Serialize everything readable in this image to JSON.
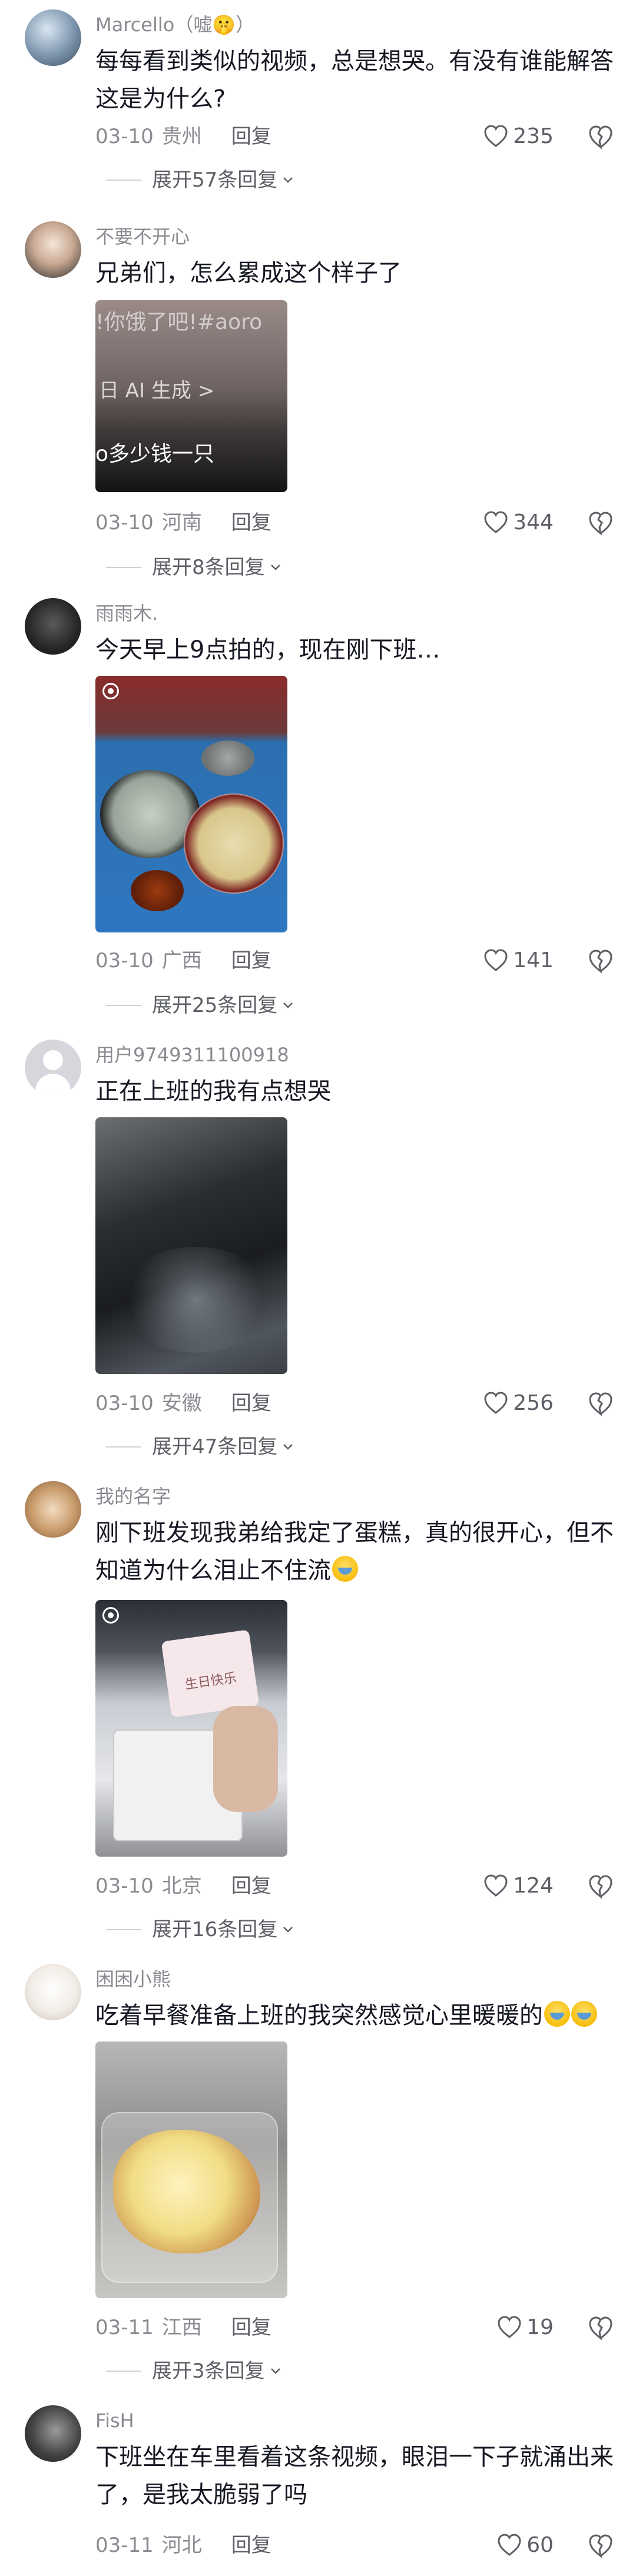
{
  "comments": [
    {
      "username": "Marcello（嘘🤫）",
      "text": "每每看到类似的视频，总是想哭。有没有谁能解答这是为什么?",
      "date": "03-10",
      "location": "贵州",
      "reply": "回复",
      "likes": "235",
      "expand": "展开57条回复"
    },
    {
      "username": "不要不开心",
      "text": "兄弟们，怎么累成这个样子了",
      "image_text_1": "!你饿了吧!#aoro",
      "image_text_2": "日 AI 生成 >",
      "image_text_3": "o多少钱一只",
      "date": "03-10",
      "location": "河南",
      "reply": "回复",
      "likes": "344",
      "expand": "展开8条回复"
    },
    {
      "username": "雨雨木.",
      "text": "今天早上9点拍的，现在刚下班…",
      "date": "03-10",
      "location": "广西",
      "reply": "回复",
      "likes": "141",
      "expand": "展开25条回复"
    },
    {
      "username": "用户9749311100918",
      "text": "正在上班的我有点想哭",
      "date": "03-10",
      "location": "安徽",
      "reply": "回复",
      "likes": "256",
      "expand": "展开47条回复"
    },
    {
      "username": "我的名字",
      "text": "刚下班发现我弟给我定了蛋糕，真的很开心，但不知道为什么泪止不住流",
      "image_card_text": "生日快乐",
      "date": "03-10",
      "location": "北京",
      "reply": "回复",
      "likes": "124",
      "expand": "展开16条回复"
    },
    {
      "username": "困困小熊",
      "text": "吃着早餐准备上班的我突然感觉心里暖暖的",
      "date": "03-11",
      "location": "江西",
      "reply": "回复",
      "likes": "19",
      "expand": "展开3条回复"
    },
    {
      "username": "FisH",
      "text": "下班坐在车里看着这条视频，眼泪一下子就涌出来了，是我太脆弱了吗",
      "date": "03-11",
      "location": "河北",
      "reply": "回复",
      "likes": "60"
    }
  ],
  "icons": {
    "heart": "heart-icon",
    "dislike": "broken-heart-icon",
    "expand": "chevron-down-icon",
    "live": "live-photo-icon"
  },
  "colors": {
    "meta_gray": "#8a8b91",
    "text": "#161823"
  }
}
